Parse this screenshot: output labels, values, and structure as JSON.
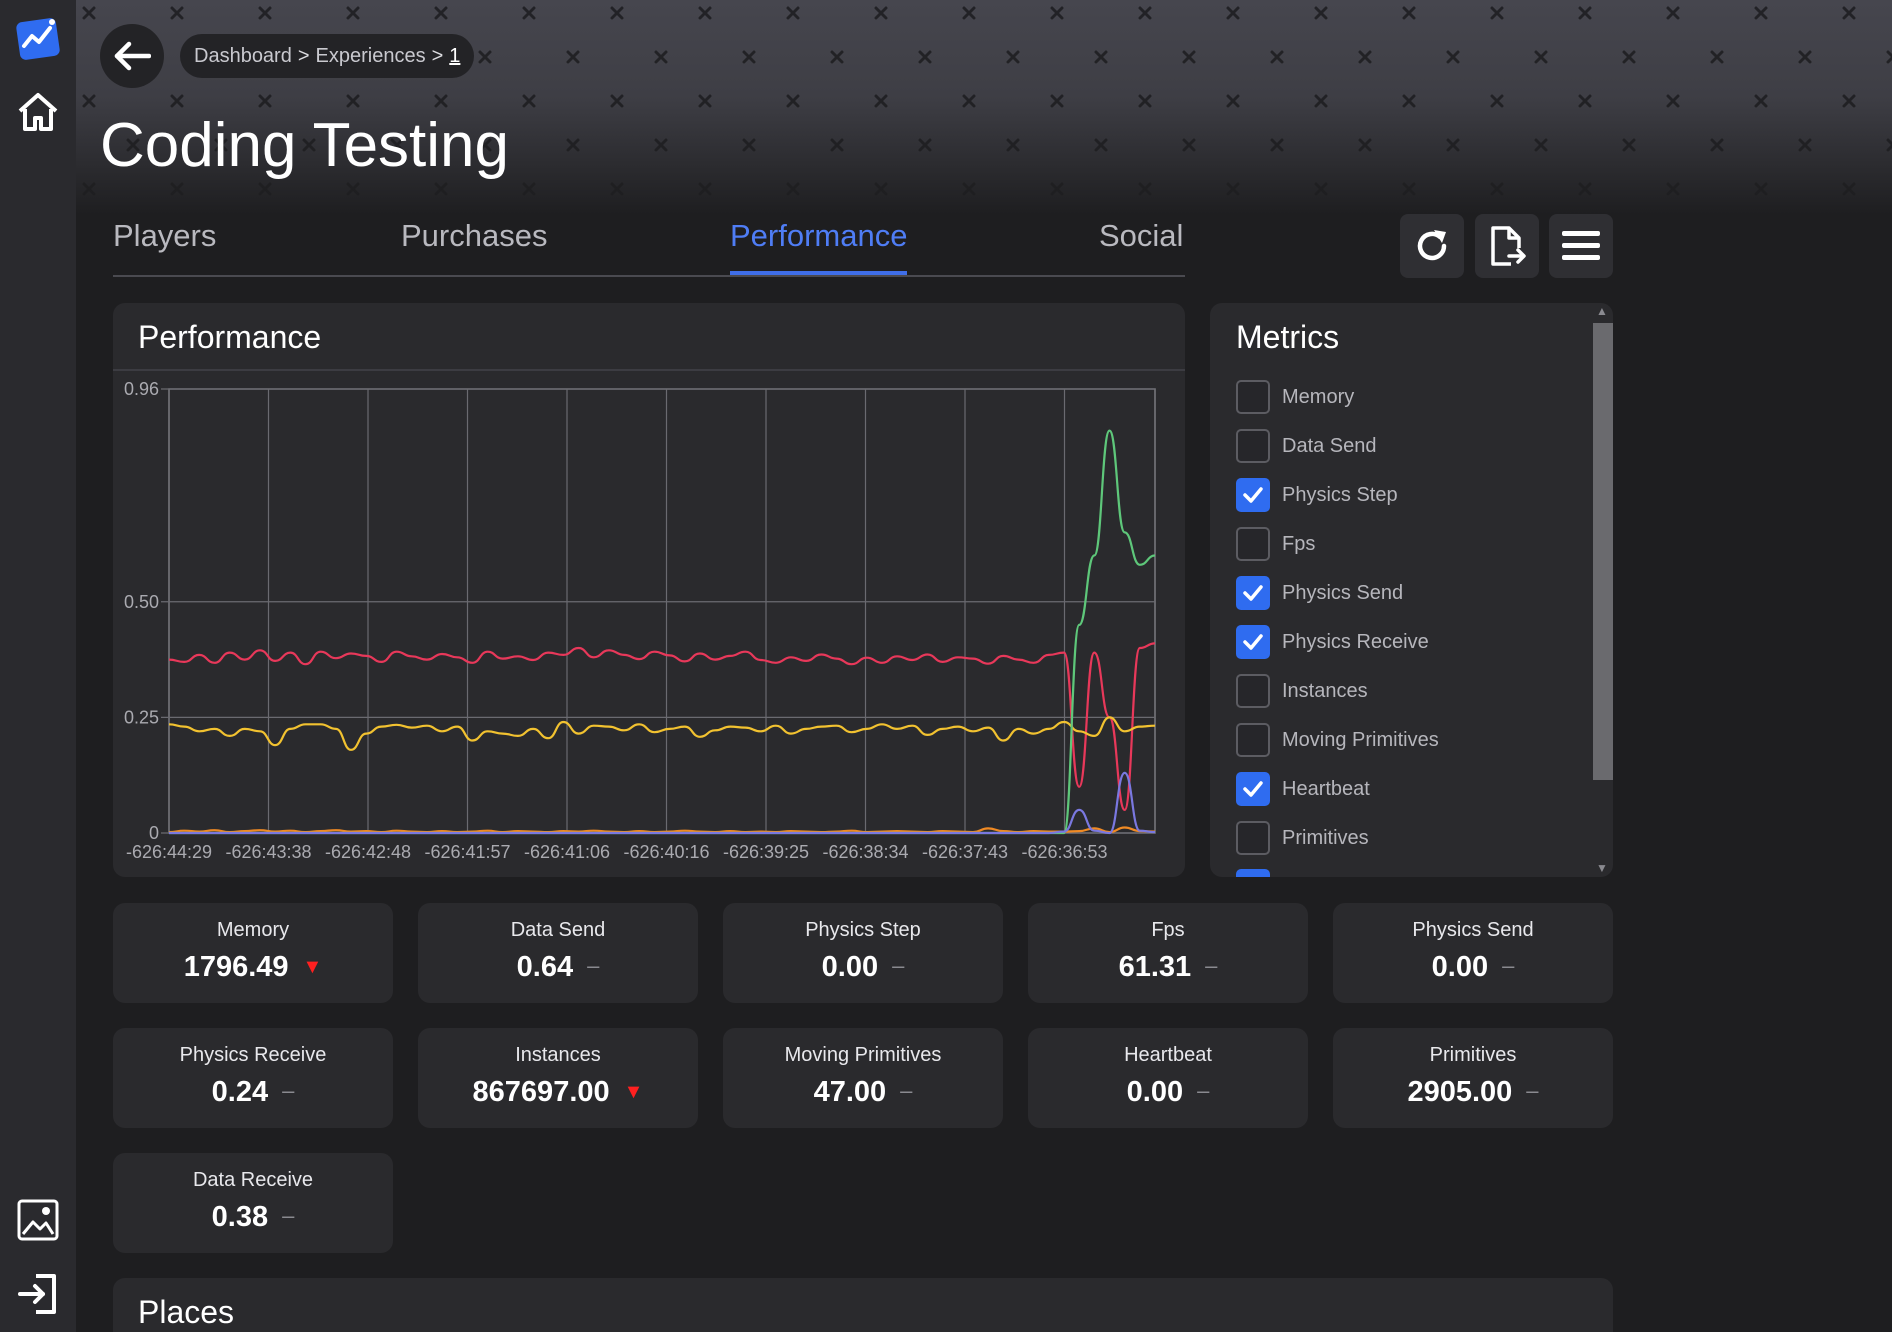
{
  "app": {
    "title": "Coding Testing"
  },
  "breadcrumb": {
    "items": [
      "Dashboard",
      "Experiences",
      "1"
    ],
    "separator": ">"
  },
  "tabs": [
    {
      "label": "Players",
      "active": false
    },
    {
      "label": "Purchases",
      "active": false
    },
    {
      "label": "Performance",
      "active": true
    },
    {
      "label": "Social",
      "active": false
    }
  ],
  "toolbar": {
    "icons": [
      "refresh-icon",
      "export-file-icon",
      "menu-icon"
    ]
  },
  "performance": {
    "title": "Performance"
  },
  "metrics": {
    "title": "Metrics",
    "items": [
      {
        "label": "Memory",
        "checked": false
      },
      {
        "label": "Data Send",
        "checked": false
      },
      {
        "label": "Physics Step",
        "checked": true
      },
      {
        "label": "Fps",
        "checked": false
      },
      {
        "label": "Physics Send",
        "checked": true
      },
      {
        "label": "Physics Receive",
        "checked": true
      },
      {
        "label": "Instances",
        "checked": false
      },
      {
        "label": "Moving Primitives",
        "checked": false
      },
      {
        "label": "Heartbeat",
        "checked": true
      },
      {
        "label": "Primitives",
        "checked": false
      }
    ]
  },
  "stats": [
    {
      "label": "Memory",
      "value": "1796.49",
      "trend": "down"
    },
    {
      "label": "Data Send",
      "value": "0.64",
      "trend": "flat"
    },
    {
      "label": "Physics Step",
      "value": "0.00",
      "trend": "flat"
    },
    {
      "label": "Fps",
      "value": "61.31",
      "trend": "flat"
    },
    {
      "label": "Physics Send",
      "value": "0.00",
      "trend": "flat"
    },
    {
      "label": "Physics Receive",
      "value": "0.24",
      "trend": "flat"
    },
    {
      "label": "Instances",
      "value": "867697.00",
      "trend": "down"
    },
    {
      "label": "Moving Primitives",
      "value": "47.00",
      "trend": "flat"
    },
    {
      "label": "Heartbeat",
      "value": "0.00",
      "trend": "flat"
    },
    {
      "label": "Primitives",
      "value": "2905.00",
      "trend": "flat"
    },
    {
      "label": "Data Receive",
      "value": "0.38",
      "trend": "flat"
    }
  ],
  "trend_symbols": {
    "down": "▼",
    "flat": "–"
  },
  "places": {
    "title": "Places"
  },
  "colors": {
    "accent": "#3f6ee8",
    "series_red": "#e8385a",
    "series_yellow": "#f2c230",
    "series_orange": "#f08a24",
    "series_green": "#5ec77a",
    "series_purple": "#7a78e0",
    "trend_down": "#ff2020"
  },
  "chart_data": {
    "type": "line",
    "title": "",
    "xlabel": "",
    "ylabel": "",
    "ylim": [
      0,
      0.96
    ],
    "y_ticks": [
      "0",
      "0.25",
      "0.50",
      "0.96"
    ],
    "x_ticks": [
      "-626:44:29",
      "-626:43:38",
      "-626:42:48",
      "-626:41:57",
      "-626:41:06",
      "-626:40:16",
      "-626:39:25",
      "-626:38:34",
      "-626:37:43",
      "-626:36:53"
    ],
    "grid": true,
    "series": [
      {
        "color": "#e8385a",
        "values": [
          0.375,
          0.37,
          0.385,
          0.368,
          0.39,
          0.375,
          0.395,
          0.372,
          0.39,
          0.365,
          0.392,
          0.378,
          0.388,
          0.383,
          0.37,
          0.392,
          0.382,
          0.375,
          0.387,
          0.38,
          0.368,
          0.392,
          0.377,
          0.382,
          0.374,
          0.39,
          0.385,
          0.4,
          0.38,
          0.395,
          0.385,
          0.376,
          0.392,
          0.384,
          0.371,
          0.388,
          0.375,
          0.383,
          0.392,
          0.374,
          0.368,
          0.38,
          0.372,
          0.386,
          0.377,
          0.365,
          0.379,
          0.368,
          0.382,
          0.374,
          0.386,
          0.37,
          0.38,
          0.377,
          0.366,
          0.383,
          0.375,
          0.368,
          0.385,
          0.39,
          0.1,
          0.39,
          0.25,
          0.05,
          0.4,
          0.41
        ]
      },
      {
        "color": "#f2c230",
        "values": [
          0.235,
          0.23,
          0.22,
          0.225,
          0.21,
          0.225,
          0.22,
          0.19,
          0.225,
          0.235,
          0.235,
          0.225,
          0.18,
          0.215,
          0.23,
          0.234,
          0.228,
          0.232,
          0.22,
          0.23,
          0.2,
          0.22,
          0.215,
          0.21,
          0.225,
          0.205,
          0.24,
          0.215,
          0.232,
          0.23,
          0.222,
          0.235,
          0.218,
          0.225,
          0.23,
          0.208,
          0.222,
          0.23,
          0.228,
          0.22,
          0.232,
          0.215,
          0.225,
          0.23,
          0.232,
          0.218,
          0.225,
          0.235,
          0.225,
          0.232,
          0.212,
          0.225,
          0.23,
          0.22,
          0.228,
          0.2,
          0.225,
          0.215,
          0.225,
          0.24,
          0.22,
          0.21,
          0.25,
          0.22,
          0.23,
          0.232
        ]
      },
      {
        "color": "#f08a24",
        "values": [
          0.002,
          0.005,
          0.003,
          0.006,
          0.002,
          0.004,
          0.006,
          0.003,
          0.005,
          0.002,
          0.004,
          0.006,
          0.003,
          0.004,
          0.002,
          0.005,
          0.003,
          0.002,
          0.004,
          0.002,
          0.003,
          0.005,
          0.002,
          0.004,
          0.003,
          0.002,
          0.004,
          0.003,
          0.005,
          0.003,
          0.002,
          0.004,
          0.002,
          0.003,
          0.005,
          0.003,
          0.002,
          0.004,
          0.002,
          0.003,
          0.002,
          0.004,
          0.003,
          0.002,
          0.003,
          0.005,
          0.002,
          0.003,
          0.004,
          0.003,
          0.002,
          0.004,
          0.003,
          0.002,
          0.01,
          0.004,
          0.002,
          0.004,
          0.003,
          0.003,
          0.004,
          0.01,
          0.002,
          0.012,
          0.004,
          0.003
        ]
      },
      {
        "color": "#5ec77a",
        "values": [
          0,
          0,
          0,
          0,
          0,
          0,
          0,
          0,
          0,
          0,
          0,
          0,
          0,
          0,
          0,
          0,
          0,
          0,
          0,
          0,
          0,
          0,
          0,
          0,
          0,
          0,
          0,
          0,
          0,
          0,
          0,
          0,
          0,
          0,
          0,
          0,
          0,
          0,
          0,
          0,
          0,
          0,
          0,
          0,
          0,
          0,
          0,
          0,
          0,
          0,
          0,
          0,
          0,
          0,
          0,
          0,
          0,
          0,
          0,
          0,
          0.45,
          0.6,
          0.87,
          0.65,
          0.58,
          0.6
        ]
      },
      {
        "color": "#7a78e0",
        "values": [
          0,
          0,
          0,
          0,
          0,
          0,
          0,
          0,
          0,
          0,
          0,
          0,
          0,
          0,
          0,
          0,
          0,
          0,
          0,
          0,
          0,
          0,
          0,
          0,
          0,
          0,
          0,
          0,
          0,
          0,
          0,
          0,
          0,
          0,
          0,
          0,
          0,
          0,
          0,
          0,
          0,
          0,
          0,
          0,
          0,
          0,
          0,
          0,
          0,
          0,
          0,
          0,
          0,
          0,
          0,
          0,
          0,
          0,
          0,
          0.003,
          0.05,
          0.005,
          0.0,
          0.13,
          0.005,
          0.002
        ]
      }
    ]
  }
}
